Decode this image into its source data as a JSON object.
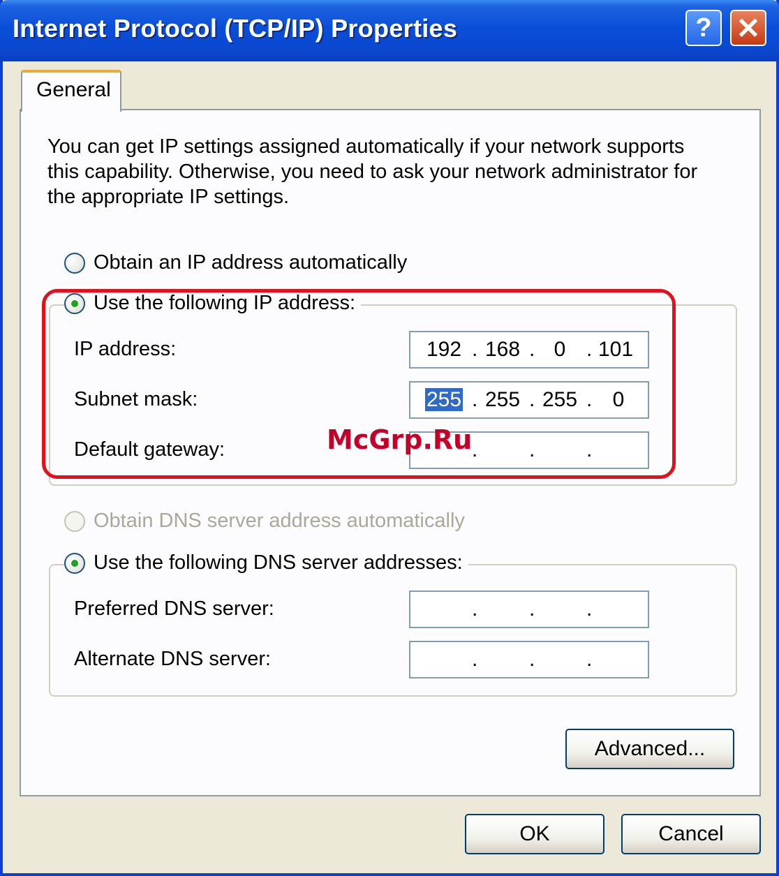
{
  "window": {
    "title": "Internet Protocol (TCP/IP) Properties",
    "help_label": "?",
    "close_label": "✕"
  },
  "tabs": [
    {
      "label": "General",
      "active": true
    }
  ],
  "description": "You can get IP settings assigned automatically if your network supports this capability. Otherwise, you need to ask your network administrator for the appropriate IP settings.",
  "ip_mode": {
    "auto_label": "Obtain an IP address automatically",
    "manual_label": "Use the following IP address:",
    "selected": "manual"
  },
  "ip_fields": [
    {
      "label": "IP address:",
      "octets": [
        "192",
        "168",
        "0",
        "101"
      ]
    },
    {
      "label": "Subnet mask:",
      "octets": [
        "255",
        "255",
        "255",
        "0"
      ]
    },
    {
      "label": "Default gateway:",
      "octets": [
        "",
        "",
        "",
        ""
      ]
    }
  ],
  "dns_mode": {
    "auto_label": "Obtain DNS server address automatically",
    "manual_label": "Use the following DNS server addresses:",
    "selected": "manual",
    "auto_disabled": true
  },
  "dns_fields": [
    {
      "label": "Preferred DNS server:",
      "octets": [
        "",
        "",
        "",
        ""
      ]
    },
    {
      "label": "Alternate DNS server:",
      "octets": [
        "",
        "",
        "",
        ""
      ]
    }
  ],
  "buttons": {
    "advanced": "Advanced...",
    "ok": "OK",
    "cancel": "Cancel"
  },
  "watermark": "McGrp.Ru",
  "colors": {
    "title_bar": "#0a4ed8",
    "dialog_bg": "#ece9d8",
    "highlight": "#e0101c",
    "selection": "#316ac5",
    "tab_accent": "#f2a73a"
  }
}
